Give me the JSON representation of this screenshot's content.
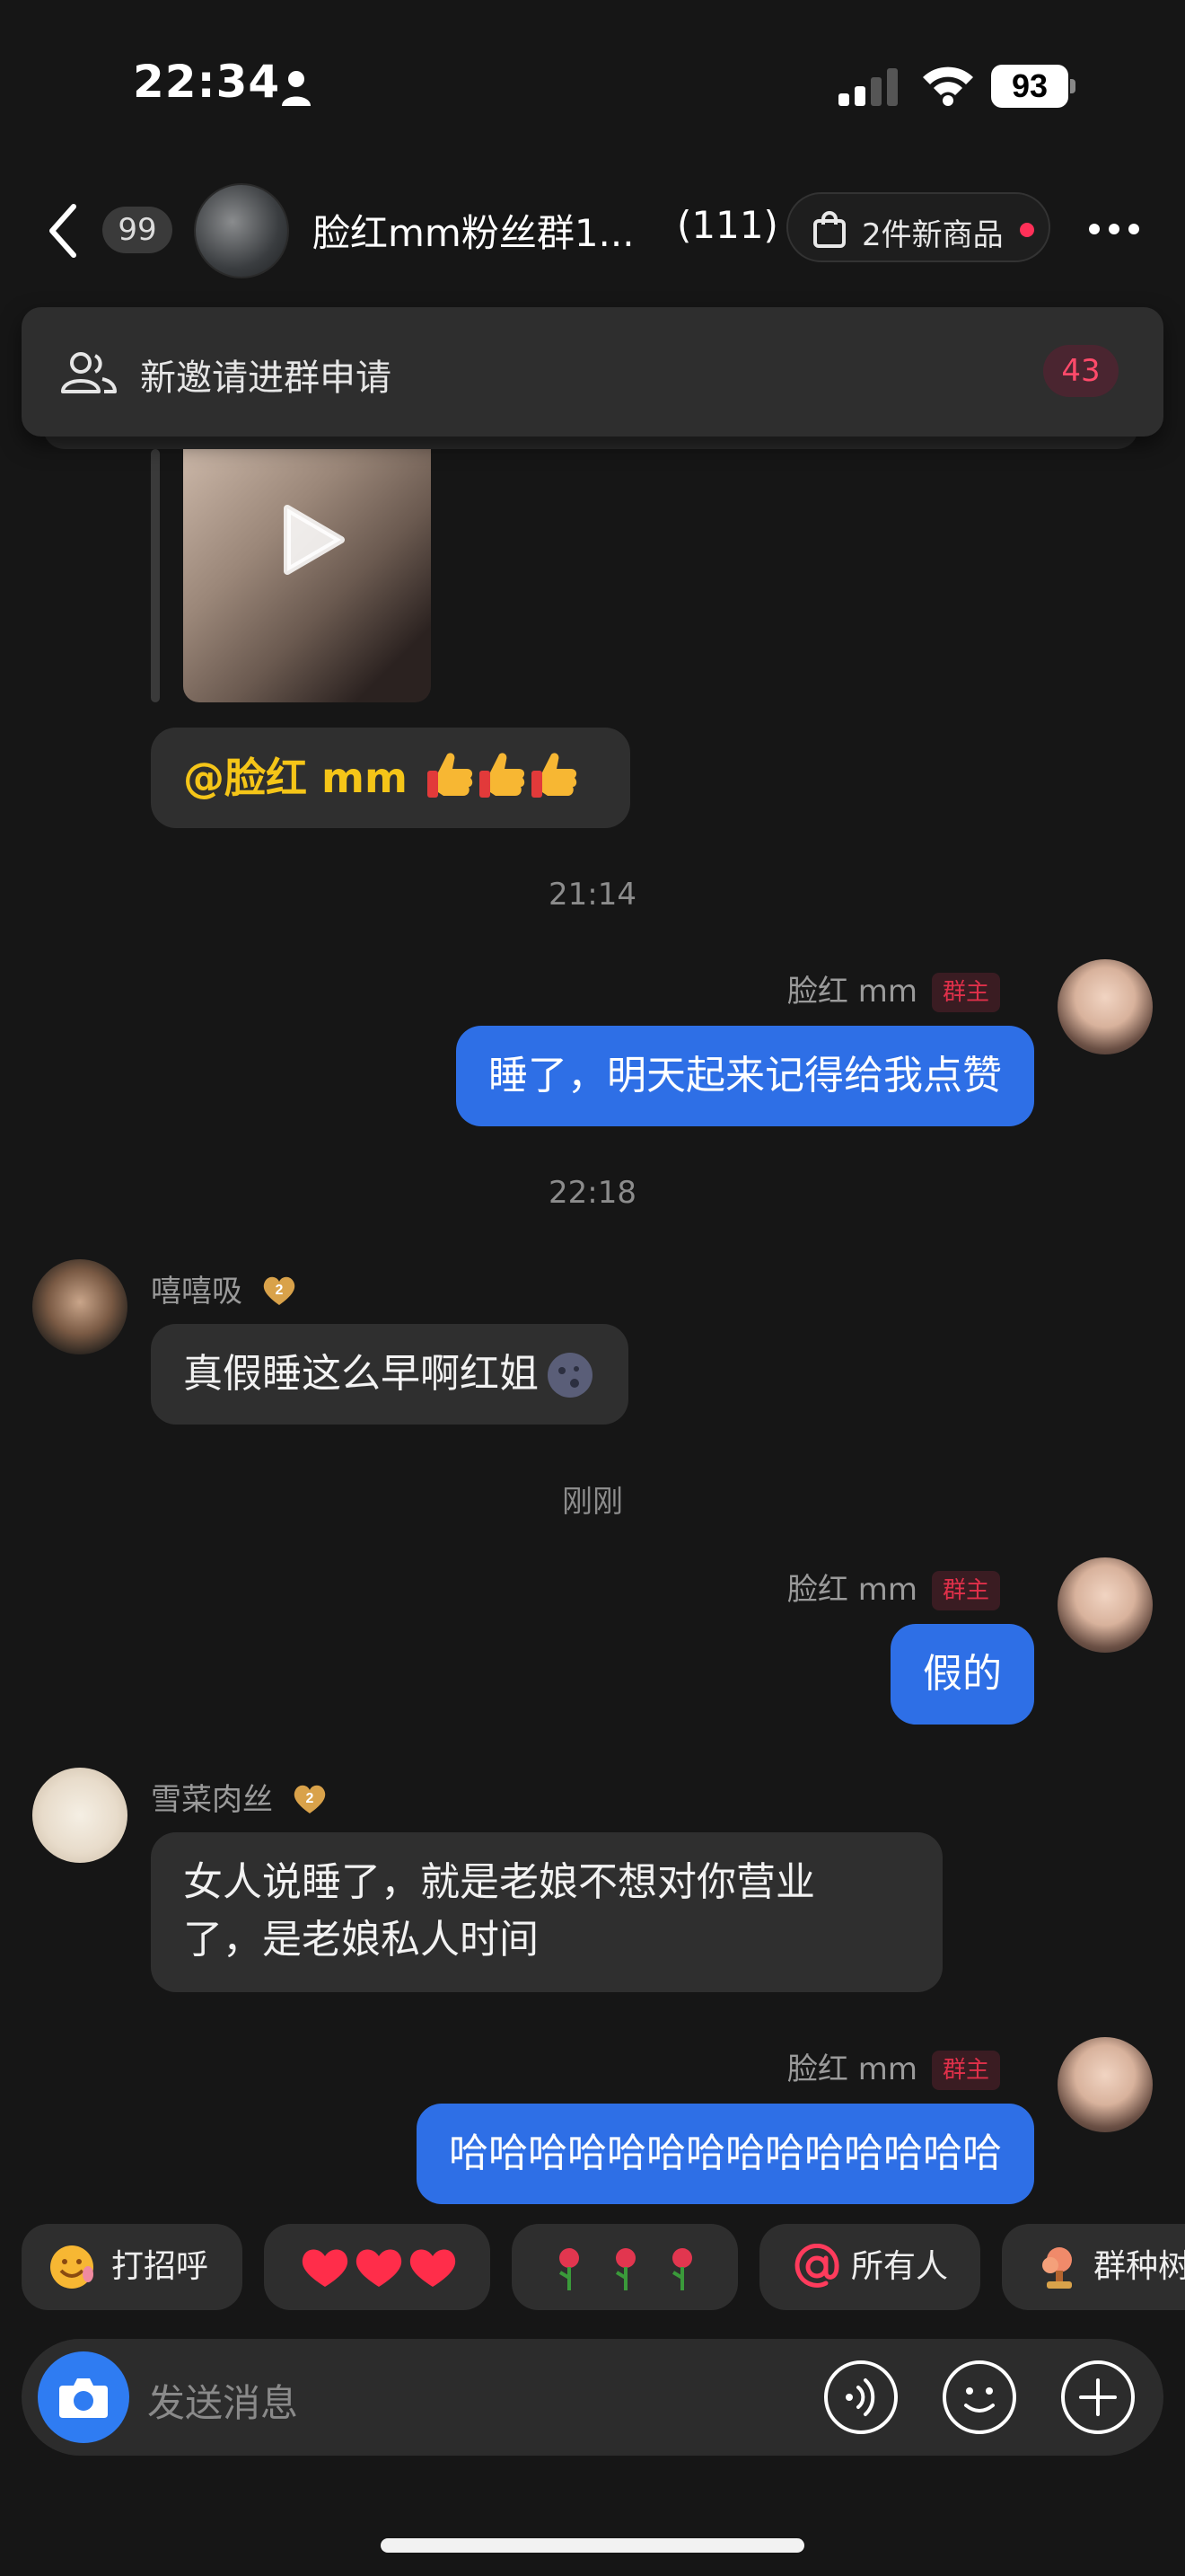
{
  "status_bar": {
    "time": "22:34",
    "battery": "93"
  },
  "header": {
    "unread_count": "99",
    "group_name": "脸红mm粉丝群1...",
    "member_count": "(111)",
    "goods_label": "2件新商品"
  },
  "invite_banner": {
    "text": "新邀请进群申请",
    "count": "43"
  },
  "messages": {
    "mention_text": "@脸红 mm",
    "time_1": "21:14",
    "owner_name": "脸红 mm",
    "owner_badge": "群主",
    "msg_1": "睡了，明天起来记得给我点赞",
    "time_2": "22:18",
    "xixi_name": "嘻嘻吸",
    "msg_2": "真假睡这么早啊红姐",
    "time_3": "刚刚",
    "msg_3": "假的",
    "xuecai_name": "雪菜肉丝",
    "msg_4_line1": "女人说睡了，就是老娘不想对你营业",
    "msg_4_line2": "了，是老娘私人时间",
    "msg_5": "哈哈哈哈哈哈哈哈哈哈哈哈哈哈"
  },
  "quick_replies": {
    "greet": "打招呼",
    "everyone": "所有人",
    "plant": "群种树"
  },
  "input": {
    "placeholder": "发送消息"
  },
  "colors": {
    "background": "#161616",
    "my_bubble": "#2e6fe6",
    "other_bubble": "#2f2f2f",
    "owner_badge": "#e0304a",
    "mention": "#f5c518"
  },
  "icons": [
    "person-icon",
    "signal-icon",
    "wifi-icon",
    "back-icon",
    "bag-icon",
    "more-icon",
    "users-icon",
    "play-icon",
    "camera-icon",
    "voice-icon",
    "emoji-icon",
    "plus-icon"
  ]
}
